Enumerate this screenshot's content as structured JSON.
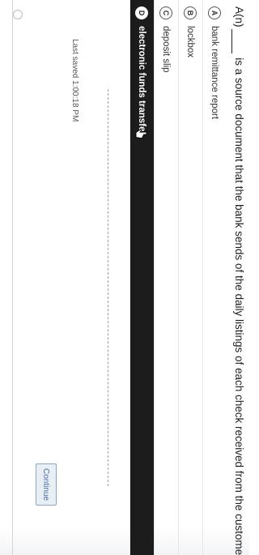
{
  "question": {
    "prefix": "A(n)",
    "text": "is a source document that the bank sends of the daily listings of each check received from the customers."
  },
  "options": [
    {
      "letter": "A",
      "label": "bank remittance report",
      "selected": false
    },
    {
      "letter": "B",
      "label": "lockbox",
      "selected": false
    },
    {
      "letter": "C",
      "label": "deposit slip",
      "selected": false
    },
    {
      "letter": "D",
      "label": "electronic funds transfer",
      "selected": true
    }
  ],
  "status": {
    "last_saved": "Last saved 1:00:18 PM"
  },
  "actions": {
    "continue_label": "Continue"
  }
}
